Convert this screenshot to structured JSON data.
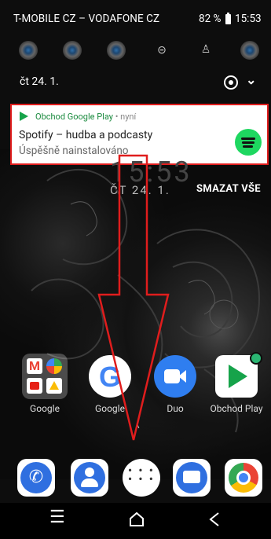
{
  "status_bar": {
    "carrier": "T-MOBILE CZ – VODAFONE CZ",
    "battery": "82 %",
    "time": "15:53"
  },
  "quick_settings": {
    "date": "čt 24. 1."
  },
  "notification": {
    "app": "Obchod Google Play",
    "time": "• nyní",
    "title": "Spotify – hudba a podcasty",
    "subtitle": "Úspěšně nainstalováno"
  },
  "lock": {
    "time_fragment": "15:53",
    "date": "ČT 24. 1."
  },
  "clear_all": "SMAZAT VŠE",
  "apps": {
    "labels": [
      "Google",
      "Google",
      "Duo",
      "Obchod Play"
    ]
  },
  "colors": {
    "notification_border": "#e01d1d",
    "play_green": "#16a34a",
    "spotify_green": "#1ed760",
    "arrow": "#e01d1d"
  }
}
